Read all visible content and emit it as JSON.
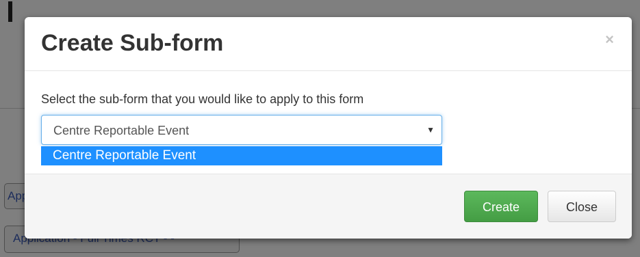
{
  "background": {
    "chip_short": "App",
    "chip_long": "Application - Full Times RCT - -"
  },
  "modal": {
    "title": "Create Sub-form",
    "close_glyph": "×",
    "prompt": "Select the sub-form that you would like to apply to this form",
    "select": {
      "value": "Centre Reportable Event",
      "caret": "▼",
      "options": [
        "Centre Reportable Event"
      ]
    },
    "buttons": {
      "create_label": "Create",
      "close_label": "Close"
    }
  },
  "colors": {
    "primary_green": "#5cb85c",
    "highlight_blue": "#1e90ff",
    "focus_border": "#66afe9"
  }
}
